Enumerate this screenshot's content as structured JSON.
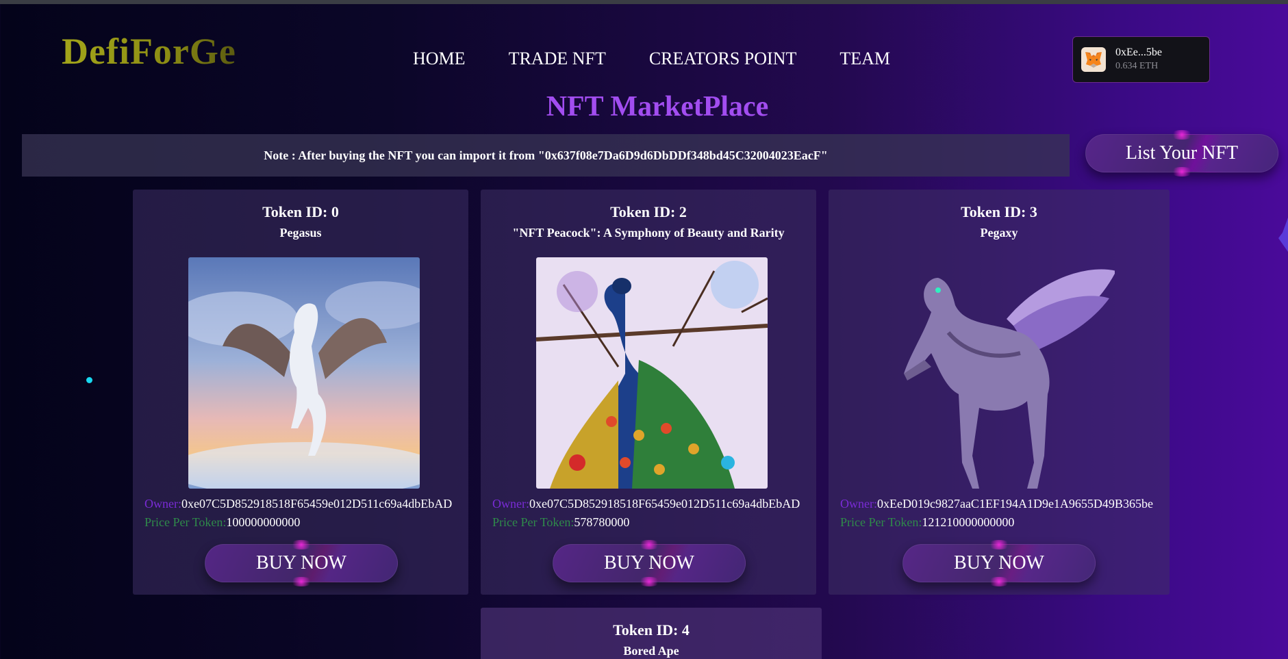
{
  "brand": {
    "logo": "DefiForGe"
  },
  "nav": {
    "items": [
      "HOME",
      "TRADE NFT",
      "CREATORS POINT",
      "TEAM"
    ]
  },
  "wallet": {
    "address": "0xEe...5be",
    "balance": "0.634 ETH",
    "icon": "metamask-fox-icon"
  },
  "page": {
    "title": "NFT MarketPlace"
  },
  "note": {
    "text": "Note : After buying the NFT you can import it from \"0x637f08e7Da6D9d6DbDDf348bd45C32004023EacF\""
  },
  "list_button": {
    "label": "List Your NFT"
  },
  "labels": {
    "owner": "Owner:",
    "price": "Price Per Token:",
    "buy": "BUY NOW"
  },
  "cards": [
    {
      "token": "Token ID: 0",
      "name": "Pegasus",
      "owner": "0xe07C5D852918518F65459e012D511c69a4dbEbAD",
      "price": "100000000000"
    },
    {
      "token": "Token ID: 2",
      "name": "\"NFT Peacock\": A Symphony of Beauty and Rarity",
      "owner": "0xe07C5D852918518F65459e012D511c69a4dbEbAD",
      "price": "578780000"
    },
    {
      "token": "Token ID: 3",
      "name": "Pegaxy",
      "owner": "0xEeD019c9827aaC1EF194A1D9e1A9655D49B365be",
      "price": "121210000000000"
    },
    {
      "token": "Token ID: 4",
      "name": "Bored Ape"
    }
  ],
  "colors": {
    "accent": "#a24df0",
    "owner_label": "#7a2bd6",
    "price_label": "#2f8a4a",
    "logo": "#a3a51a"
  }
}
